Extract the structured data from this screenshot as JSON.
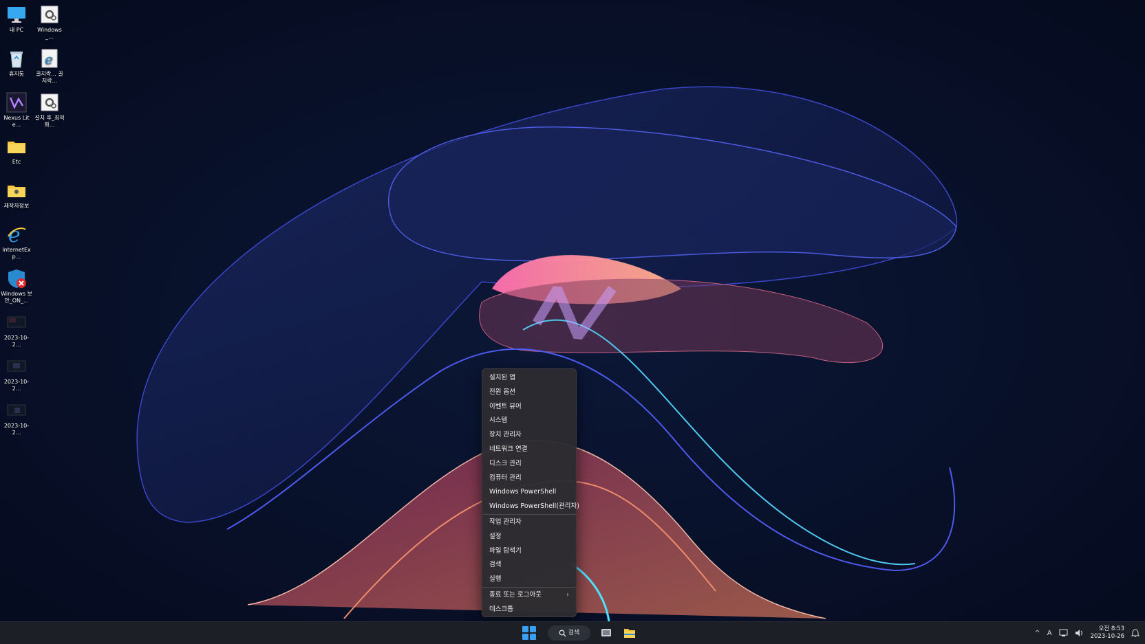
{
  "desktop": {
    "icons": [
      {
        "label": "내 PC",
        "icon": "monitor-icon"
      },
      {
        "label": "Windows_...",
        "icon": "settings-file-icon"
      },
      {
        "label": "휴지통",
        "icon": "recycle-bin-icon"
      },
      {
        "label": "꿀지락... 꿀지락...",
        "icon": "internet-explorer-icon"
      },
      {
        "label": "Nexus Lite...",
        "icon": "nexus-icon"
      },
      {
        "label": "설치 후_최적화...",
        "icon": "settings-file-icon"
      },
      {
        "label": "Etc",
        "icon": "folder-icon"
      },
      {
        "label": "제작자정보",
        "icon": "folder-icon"
      },
      {
        "label": "InternetExp...",
        "icon": "internet-explorer-icon"
      },
      {
        "label": "Windows 보안_ON_...",
        "icon": "windows-security-icon"
      },
      {
        "label": "2023-10-2...",
        "icon": "screenshot-thumb-icon"
      },
      {
        "label": "2023-10-2...",
        "icon": "screenshot-thumb-icon"
      },
      {
        "label": "2023-10-2...",
        "icon": "screenshot-thumb-icon"
      }
    ]
  },
  "context_menu": {
    "items": [
      "설치된 앱",
      "전원 옵션",
      "이벤트 뷰어",
      "시스템",
      "장치 관리자",
      "네트워크 연결",
      "디스크 관리",
      "컴퓨터 관리",
      "Windows PowerShell",
      "Windows PowerShell(관리자)",
      "작업 관리자",
      "설정",
      "파일 탐색기",
      "검색",
      "실행",
      "종료 또는 로그아웃",
      "데스크톱"
    ],
    "submenu_chevron": "›"
  },
  "taskbar": {
    "search_label": "검색",
    "tray": {
      "chevron": "^",
      "ime": "A",
      "time": "오전 8:53",
      "date": "2023-10-26"
    }
  },
  "colors": {
    "start_blue": "#3aa0f0",
    "taskbar_bg": "#1c1f26",
    "menu_bg": "#2c2c30"
  }
}
